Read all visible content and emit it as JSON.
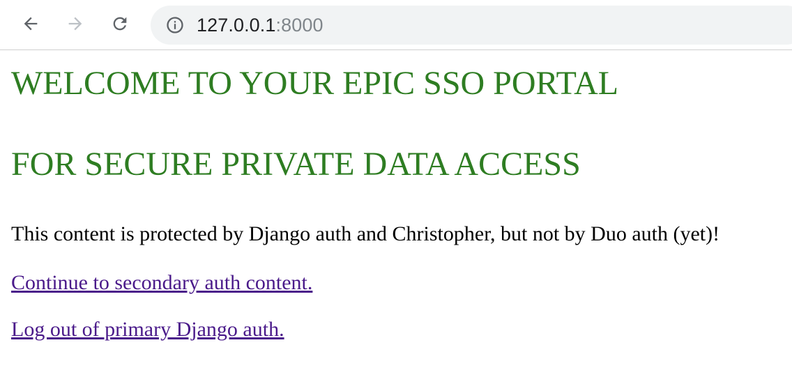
{
  "browser": {
    "url_host": "127.0.0.1",
    "url_port": ":8000",
    "icons": {
      "back": "back-arrow-icon",
      "forward": "forward-arrow-icon",
      "reload": "reload-icon",
      "info": "info-icon"
    }
  },
  "page": {
    "heading1": "WELCOME TO YOUR EPIC SSO PORTAL",
    "heading2": "FOR SECURE PRIVATE DATA ACCESS",
    "message": "This content is protected by Django auth and Christopher, but not by Duo auth (yet)!",
    "link_secondary": "Continue to secondary auth content.",
    "link_logout": "Log out of primary Django auth.",
    "colors": {
      "heading": "#2e7d22",
      "visited_link": "#4a1a8a"
    }
  }
}
